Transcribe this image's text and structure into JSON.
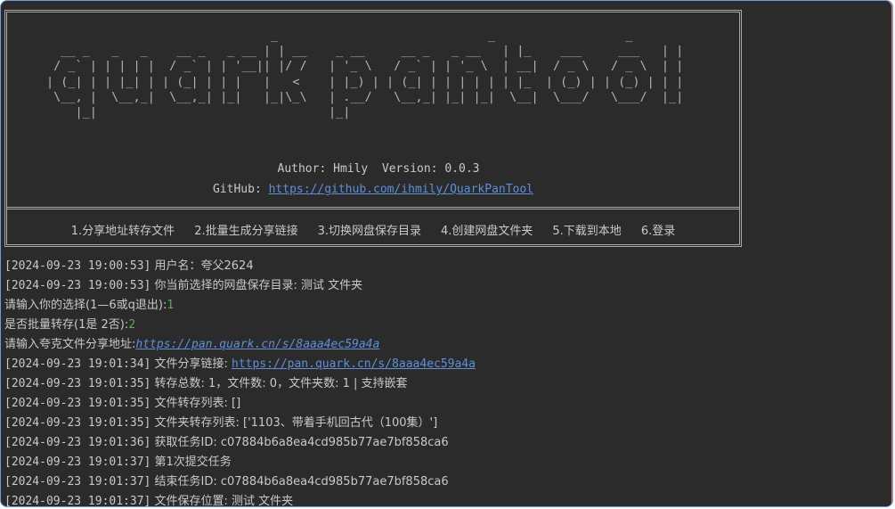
{
  "banner": {
    "ascii": [
      "                               _                             _                  _",
      "  __ _   _   _    __ _   _ __ | | __    _ __     __ _   _ __   | |_    ___     ___   | |",
      " / _` | | | | |  / _` | | '__|| |/ /   | '_ \\   / _` | | '_ \\  | __|  / _ \\   / _ \\  | |",
      "| (_| | | |_| | | (_| | | |   |   <    | |_) | | (_| | | | | | | |_  | (_) | | (_) | | |",
      " \\__, |  \\__,_|  \\__,_| |_|   |_|\\_\\   | .__/   \\__,_| |_| |_|  \\__|  \\___/   \\___/  |_|",
      "    |_|                                |_|"
    ],
    "author_line": "Author: Hmily  Version: 0.0.3",
    "github_label": "GitHub: ",
    "github_url": "https://github.com/ihmily/QuarkPanTool"
  },
  "menu": [
    "1.分享地址转存文件",
    "2.批量生成分享链接",
    "3.切换网盘保存目录",
    "4.创建网盘文件夹",
    "5.下载到本地",
    "6.登录"
  ],
  "log": [
    {
      "ts": "[2024-09-23 19:00:53]",
      "text": " 用户名：夸父2624"
    },
    {
      "ts": "[2024-09-23 19:00:53]",
      "text": " 你当前选择的网盘保存目录: 测试 文件夹"
    },
    {
      "prompt": "请输入你的选择(1—6或q退出):",
      "input": "1"
    },
    {
      "prompt": "是否批量转存(1是 2否):",
      "input": "2"
    },
    {
      "prompt": "请输入夸克文件分享地址:",
      "link": "https://pan.quark.cn/s/8aaa4ec59a4a"
    },
    {
      "ts": "[2024-09-23 19:01:34]",
      "text": " 文件分享链接: ",
      "link": "https://pan.quark.cn/s/8aaa4ec59a4a"
    },
    {
      "ts": "[2024-09-23 19:01:35]",
      "text": " 转存总数: 1，文件数: 0，文件夹数: 1 | 支持嵌套"
    },
    {
      "ts": "[2024-09-23 19:01:35]",
      "text": " 文件转存列表: []"
    },
    {
      "ts": "[2024-09-23 19:01:35]",
      "text": " 文件夹转存列表: ['1103、带着手机回古代（100集）']"
    },
    {
      "ts": "[2024-09-23 19:01:36]",
      "text": " 获取任务ID: c07884b6a8ea4cd985b77ae7bf858ca6"
    },
    {
      "ts": "[2024-09-23 19:01:37]",
      "text": " 第1次提交任务"
    },
    {
      "ts": "[2024-09-23 19:01:37]",
      "text": " 结束任务ID: c07884b6a8ea4cd985b77ae7bf858ca6"
    },
    {
      "ts": "[2024-09-23 19:01:37]",
      "text": " 文件保存位置: 测试 文件夹"
    }
  ],
  "colors": {
    "background": "#2b2b2b",
    "text": "#c9c9c9",
    "link": "#5f8fd8",
    "input": "#5ea75e"
  }
}
